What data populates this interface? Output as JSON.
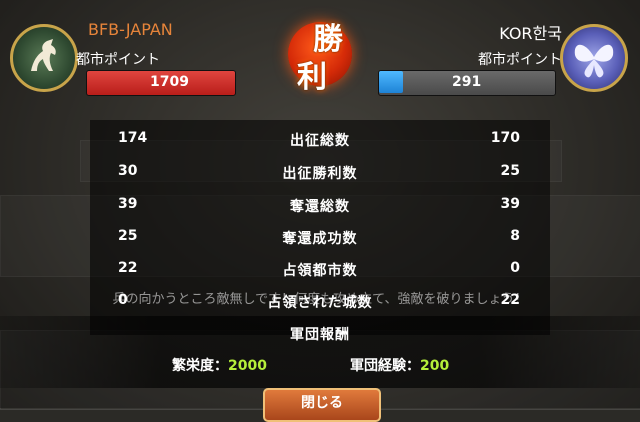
{
  "header": {
    "left_team": "BFB-JAPAN",
    "right_team": "KOR한국",
    "left_points_label": "都市ポイント",
    "right_points_label": "都市ポイント",
    "left_points": "1709",
    "right_points": "291",
    "left_points_value": 1709,
    "right_points_value": 291,
    "result_char_1": "勝",
    "result_char_2": "利"
  },
  "stats": [
    {
      "label": "出征総数",
      "left": "174",
      "right": "170"
    },
    {
      "label": "出征勝利数",
      "left": "30",
      "right": "25"
    },
    {
      "label": "奪還総数",
      "left": "39",
      "right": "39"
    },
    {
      "label": "奪還成功数",
      "left": "25",
      "right": "8"
    },
    {
      "label": "占領都市数",
      "left": "22",
      "right": "0"
    },
    {
      "label": "占領された城数",
      "left": "0",
      "right": "22"
    }
  ],
  "background_message": "兵の向かうところ敵無しです！何度も攻め立て、強敵を破りましょう！",
  "rewards": {
    "title": "軍団報酬",
    "prosperity_label": "繁栄度：",
    "prosperity_value": "2000",
    "exp_label": "軍団経験：",
    "exp_value": "200"
  },
  "close_button": "閉じる",
  "colors": {
    "left_team": "#e6843a",
    "left_bar": "#d7352f",
    "right_bar": "#3aa2f0",
    "reward_value": "#b6f03a"
  }
}
